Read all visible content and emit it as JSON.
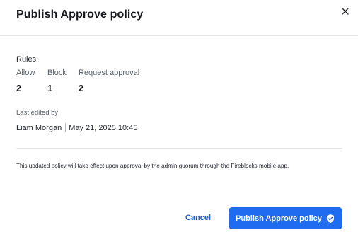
{
  "dialog": {
    "title": "Publish Approve policy",
    "close_icon": "close-icon"
  },
  "rules": {
    "title": "Rules",
    "items": [
      {
        "label": "Allow",
        "value": "2"
      },
      {
        "label": "Block",
        "value": "1"
      },
      {
        "label": "Request approval",
        "value": "2"
      }
    ]
  },
  "last_edited": {
    "label": "Last edited by",
    "user": "Liam Morgan",
    "timestamp": "May 21, 2025 10:45"
  },
  "note": "This updated policy will take effect upon approval by the admin quorum through the Fireblocks mobile app.",
  "actions": {
    "cancel_label": "Cancel",
    "publish_label": "Publish Approve policy",
    "publish_icon": "shield-check-icon",
    "primary_color": "#1f6cf0",
    "link_color": "#1a5fd6"
  }
}
